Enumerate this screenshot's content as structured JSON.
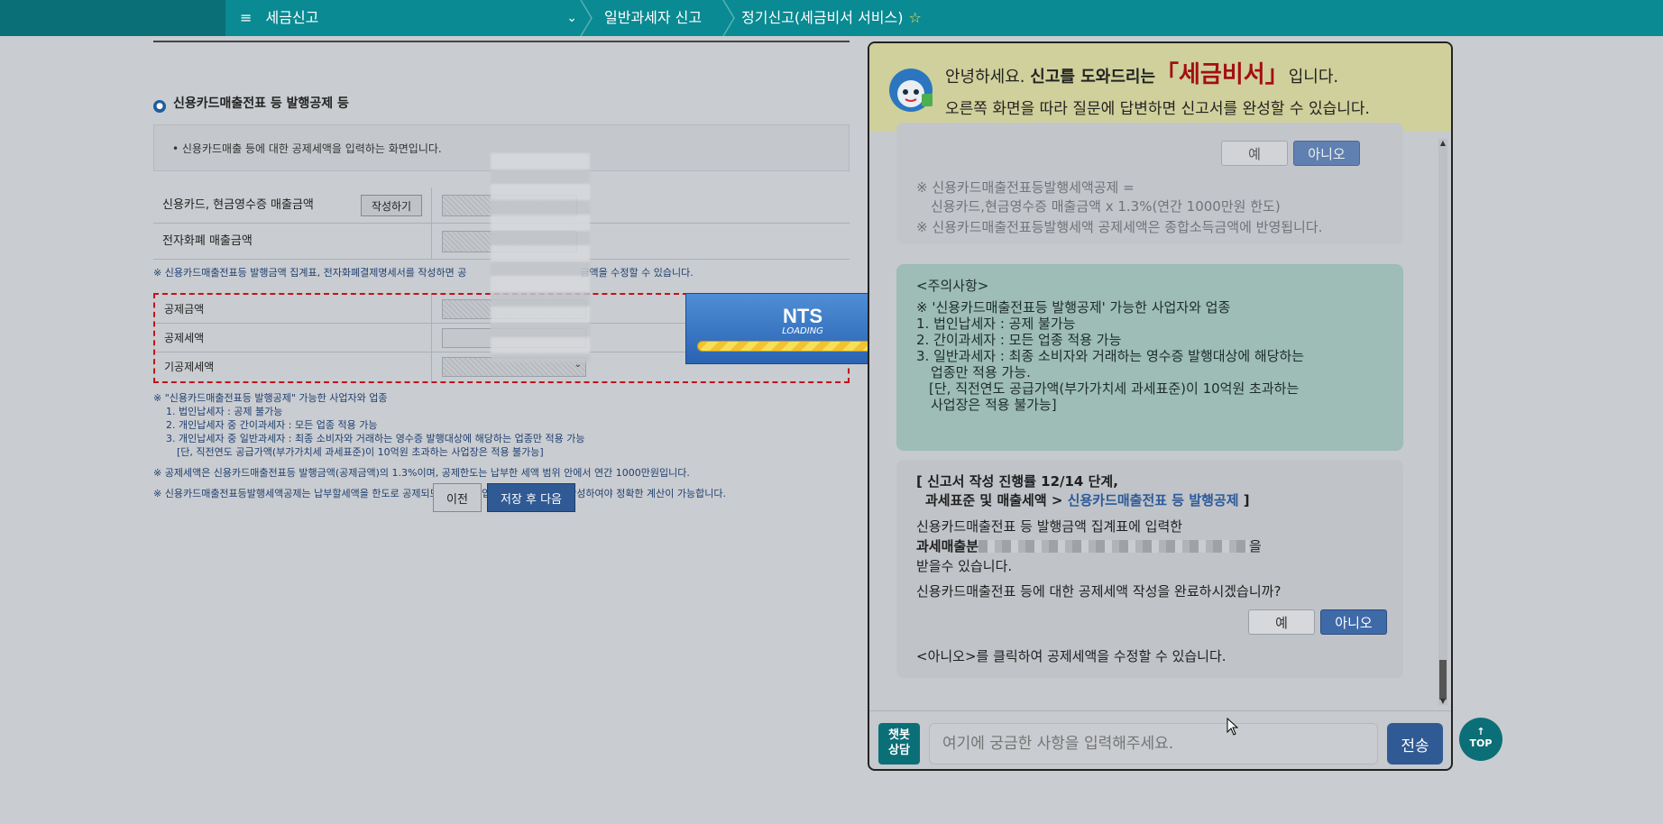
{
  "nav": {
    "menu_icon": "hamburger-icon",
    "menu_title": "세금신고",
    "crumb2": "일반과세자 신고",
    "crumb3": "정기신고(세금비서 서비스)"
  },
  "form": {
    "section_title": "신용카드매출전표 등 발행공제 등",
    "info_text": "• 신용카드매출 등에 대한 공제세액을 입력하는 화면입니다.",
    "row1_label": "신용카드, 현금영수증 매출금액",
    "row1_button": "작성하기",
    "row2_label": "전자화폐 매출금액",
    "note1": "※ 신용카드매출전표등 발행금액 집계표, 전자화폐결제명세서를 작성하면 공",
    "note1_tail": "금액을 수정할 수 있습니다.",
    "red_rows": [
      "공제금액",
      "공제세액",
      "기공제세액"
    ],
    "notes": {
      "n1": "※ \"신용카드매출전표등 발행공제\" 가능한 사업자와 업종",
      "n2": "1. 법인납세자 : 공제 불가능",
      "n3": "2. 개인납세자 중 간이과세자 : 모든 업종 적용 가능",
      "n4": "3. 개인납세자 중 일반과세자 : 최종 소비자와 거래하는 영수증 발행대상에 해당하는 업종만 적용 가능",
      "n5": "[단, 직전연도 공급가액(부가가치세 과세표준)이 10억원 초과하는 사업장은 적용 불가능]",
      "n6": "※ 공제세액은 신용카드매출전표등 발행금액(공제금액)의 1.3%이며, 공제한도는 납부한 세액 범위 안에서 연간 1000만원입니다.",
      "n7": "※ 신용카드매출전표등발행세액공제는 납부할세액을 한도로 공제되므로 매출·매입을 모두 입력한 후 작성하여야 정확한 계산이 가능합니다."
    },
    "btn_prev": "이전",
    "btn_next": "저장 후 다음"
  },
  "loading": {
    "brand": "NTS",
    "label": "LOADING"
  },
  "chat": {
    "greet_a": "안녕하세요.",
    "greet_b": "신고를 도와드리는",
    "greet_brand": "「세금비서」",
    "greet_c": "입니다.",
    "greet2": "오른쪽 화면을 따라 질문에 답변하면 신고서를 완성할 수 있습니다.",
    "b1": {
      "yes": "예",
      "no": "아니오",
      "t1": "※ 신용카드매출전표등발행세액공제 =",
      "t2": "신용카드,현금영수증 매출금액 x 1.3%(연간 1000만원 한도)",
      "t3": "※ 신용카드매출전표등발행세액 공제세액은 종합소득금액에 반영됩니다."
    },
    "b2": {
      "title": "<주의사항>",
      "l1": "※ '신용카드매출전표등 발행공제' 가능한 사업자와 업종",
      "l2": "1. 법인납세자 : 공제 불가능",
      "l3": "2. 간이과세자 : 모든 업종 적용 가능",
      "l4": "3. 일반과세자 : 최종 소비자와 거래하는 영수증 발행대상에 해당하는",
      "l5": "업종만 적용 가능.",
      "l6": "[단, 직전연도 공급가액(부가가치세 과세표준)이 10억원 초과하는",
      "l7": "사업장은 적용 불가능]"
    },
    "b3": {
      "stage1": "[ 신고서 작성 진행률 12/14 단계,",
      "stage2a": "과세표준 및 매출세액 >",
      "stage2b": "신용카드매출전표 등 발행공제",
      "stage2c": "]",
      "p1": "신용카드매출전표 등 발행금액 집계표에 입력한",
      "p2a": "과세매출분",
      "p2b": "을",
      "p3": "받을수 있습니다.",
      "q": "신용카드매출전표 등에 대한 공제세액 작성을 완료하시겠습니까?",
      "yes": "예",
      "no": "아니오",
      "hint": "<아니오>를 클릭하여 공제세액을 수정할 수 있습니다."
    },
    "bot_badge": "챗봇\n상담",
    "input_placeholder": "여기에 궁금한 사항을 입력해주세요.",
    "send": "전송"
  },
  "top_button": "TOP"
}
